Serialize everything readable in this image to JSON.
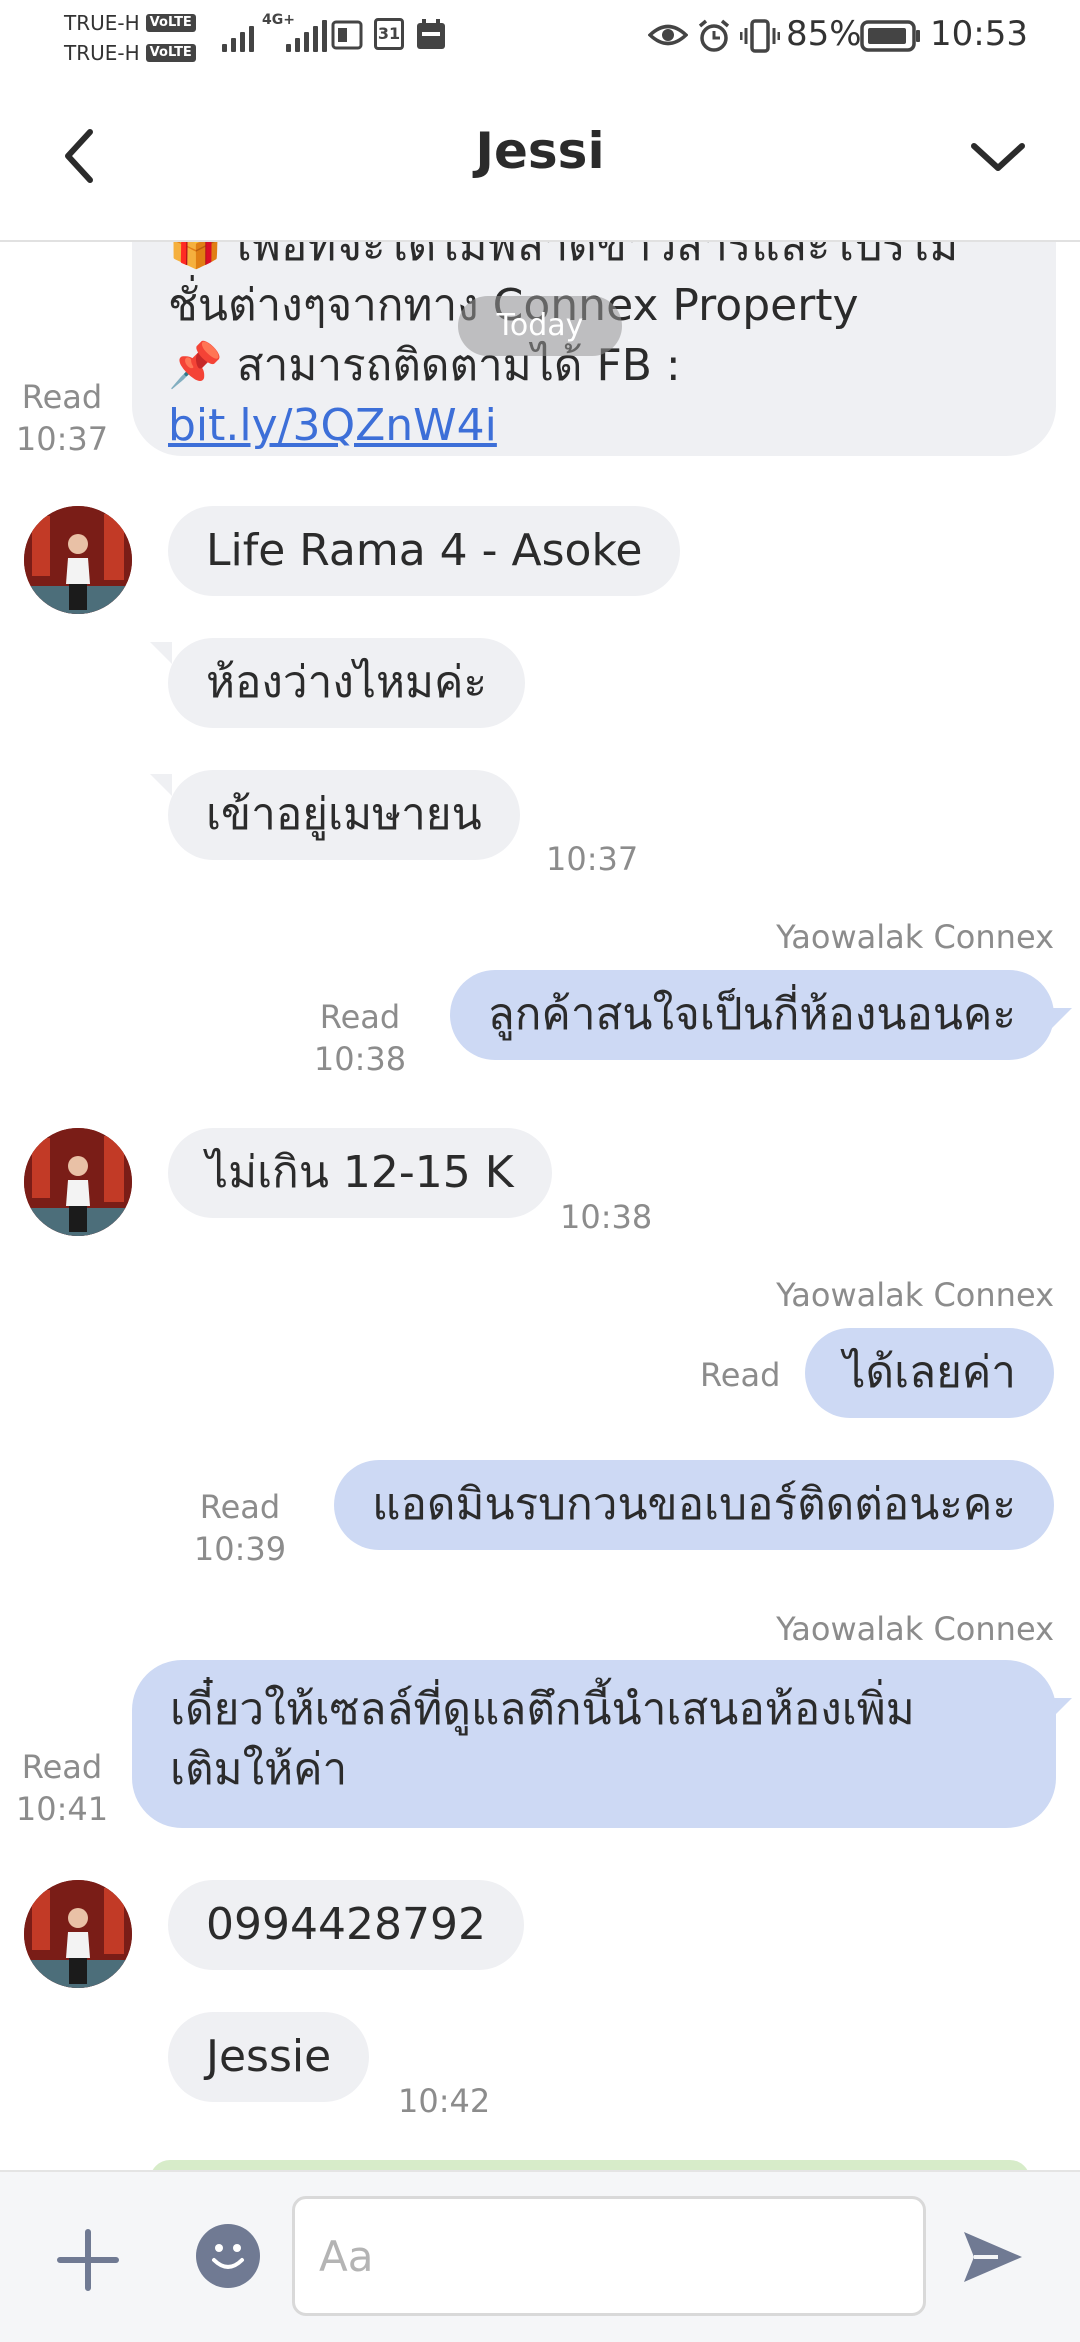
{
  "status_bar": {
    "carrier_1": "TRUE-H",
    "carrier_2": "TRUE-H",
    "volte_label": "VoLTE",
    "network_label": "4G+",
    "calendar_day": "31",
    "battery_percent": "85%",
    "time": "10:53"
  },
  "header": {
    "title": "Jessi",
    "back_icon": "chevron-left-icon",
    "menu_icon": "chevron-down-icon"
  },
  "chat": {
    "date_pill": "Today",
    "promo": {
      "line1": "🎁 เพื่อที่จะได้ไม่พลาดข่าวสารและโปรโม",
      "line2": "ชั่นต่างๆจากทาง Connex Property",
      "line3_prefix": "📌 สามารถติดตามได้ FB : ",
      "link_text": "bit.ly/3QZnW4i",
      "read": "Read",
      "time": "10:37"
    },
    "messages": [
      {
        "text": "Life Rama 4 - Asoke"
      },
      {
        "text": "ห้องว่างไหมค่ะ"
      },
      {
        "text": "เข้าอยู่เมษายน",
        "time": "10:37"
      },
      {
        "sender": "Yaowalak Connex",
        "text": "ลูกค้าสนใจเป็นกี่ห้องนอนคะ",
        "read": "Read",
        "time": "10:38"
      },
      {
        "text": "ไม่เกิน 12-15 K",
        "time": "10:38"
      },
      {
        "sender": "Yaowalak Connex",
        "text": "ได้เลยค่า",
        "read": "Read"
      },
      {
        "text": "แอดมินรบกวนขอเบอร์ติดต่อนะคะ",
        "read": "Read",
        "time": "10:39"
      },
      {
        "sender": "Yaowalak Connex",
        "line1": "เดี๋ยวให้เซลล์ที่ดูแลตึกนี้นำเสนอห้องเพิ่ม",
        "line2": "เติมให้ค่า",
        "read": "Read",
        "time": "10:41"
      },
      {
        "text": "0994428792"
      },
      {
        "text": "Jessie",
        "time": "10:42"
      }
    ]
  },
  "input_bar": {
    "placeholder": "Aa",
    "plus_icon": "plus-icon",
    "emoji_icon": "emoji-icon",
    "send_icon": "send-icon"
  },
  "colors": {
    "incoming_bubble": "#eff0f3",
    "outgoing_bubble": "#cdd9f4",
    "link": "#3d6fd8",
    "meta_text": "#8c8c8c"
  }
}
